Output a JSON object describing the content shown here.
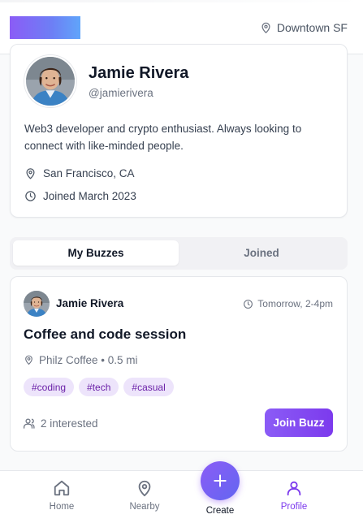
{
  "header": {
    "location": "Downtown SF",
    "icons": {
      "logo": "gradient-logo",
      "location": "map-pin-icon"
    }
  },
  "profile": {
    "name": "Jamie Rivera",
    "handle": "@jamierivera",
    "bio": "Web3 developer and crypto enthusiast. Always looking to connect with like-minded people.",
    "city": "San Francisco, CA",
    "joined": "Joined March 2023"
  },
  "tabs": [
    {
      "label": "My Buzzes",
      "active": true
    },
    {
      "label": "Joined",
      "active": false
    }
  ],
  "buzz": {
    "host": "Jamie Rivera",
    "time": "Tomorrow, 2-4pm",
    "title": "Coffee and code session",
    "place": "Philz Coffee • 0.5 mi",
    "tags": [
      "#coding",
      "#tech",
      "#casual"
    ],
    "interested": "2 interested",
    "join_label": "Join Buzz"
  },
  "nav": {
    "home": "Home",
    "nearby": "Nearby",
    "create": "Create",
    "profile": "Profile",
    "active": "Profile"
  },
  "colors": {
    "accent": "#7c3aed",
    "tag_bg": "#ede4fb",
    "tag_text": "#6b21a8",
    "background": "#f9fafb"
  }
}
